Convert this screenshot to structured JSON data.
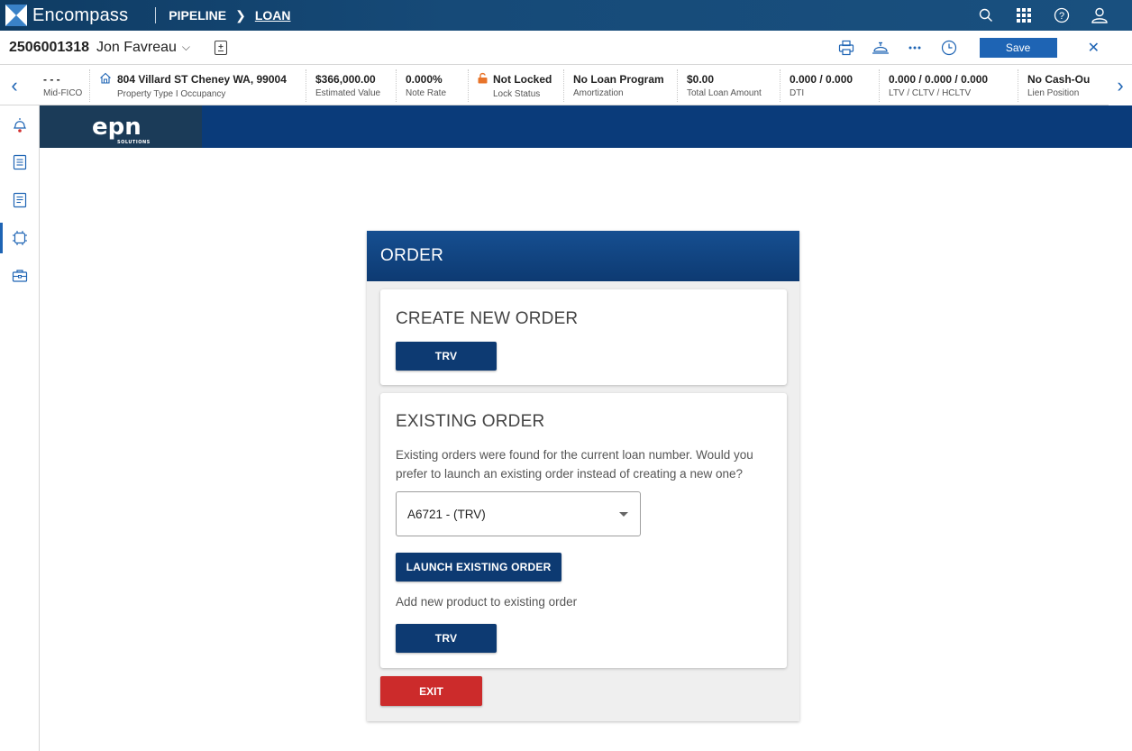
{
  "app": {
    "name": "Encompass",
    "nav": {
      "pipeline": "PIPELINE",
      "loan": "LOAN"
    }
  },
  "top_icons": [
    "search-icon",
    "apps-grid-icon",
    "help-icon",
    "user-icon"
  ],
  "loan": {
    "number": "2506001318",
    "borrower": "Jon Favreau",
    "save_label": "Save"
  },
  "info_strip": [
    {
      "value": "- - -",
      "label": "Mid-FICO"
    },
    {
      "value": "804 Villard ST Cheney WA, 99004",
      "label": "Property Type I Occupancy"
    },
    {
      "value": "$366,000.00",
      "label": "Estimated Value"
    },
    {
      "value": "0.000%",
      "label": "Note Rate"
    },
    {
      "value": "Not Locked",
      "label": "Lock Status"
    },
    {
      "value": "No Loan Program",
      "label": "Amortization"
    },
    {
      "value": "$0.00",
      "label": "Total Loan Amount"
    },
    {
      "value": "0.000 / 0.000",
      "label": "DTI"
    },
    {
      "value": "0.000 / 0.000 / 0.000",
      "label": "LTV / CLTV / HCLTV"
    },
    {
      "value": "No Cash-Ou",
      "label": "Lien Position"
    }
  ],
  "banner": {
    "logo_text": "epn",
    "logo_sub": "SOLUTIONS"
  },
  "order": {
    "title": "ORDER",
    "create": {
      "title": "CREATE NEW ORDER",
      "button": "TRV"
    },
    "existing": {
      "title": "EXISTING ORDER",
      "message": "Existing orders were found for the current loan number. Would you prefer to launch an existing order instead of creating a new one?",
      "selected_order": "A6721 - (TRV)",
      "launch_button": "LAUNCH EXISTING ORDER",
      "add_product_text": "Add new product to existing order",
      "add_button": "TRV"
    },
    "exit_button": "EXIT"
  },
  "colors": {
    "topbar": "#164a78",
    "accent": "#1e64b4",
    "banner": "#0a3b7a",
    "button": "#0d3a72",
    "exit": "#cc2b2b",
    "lock": "#e8742a"
  }
}
